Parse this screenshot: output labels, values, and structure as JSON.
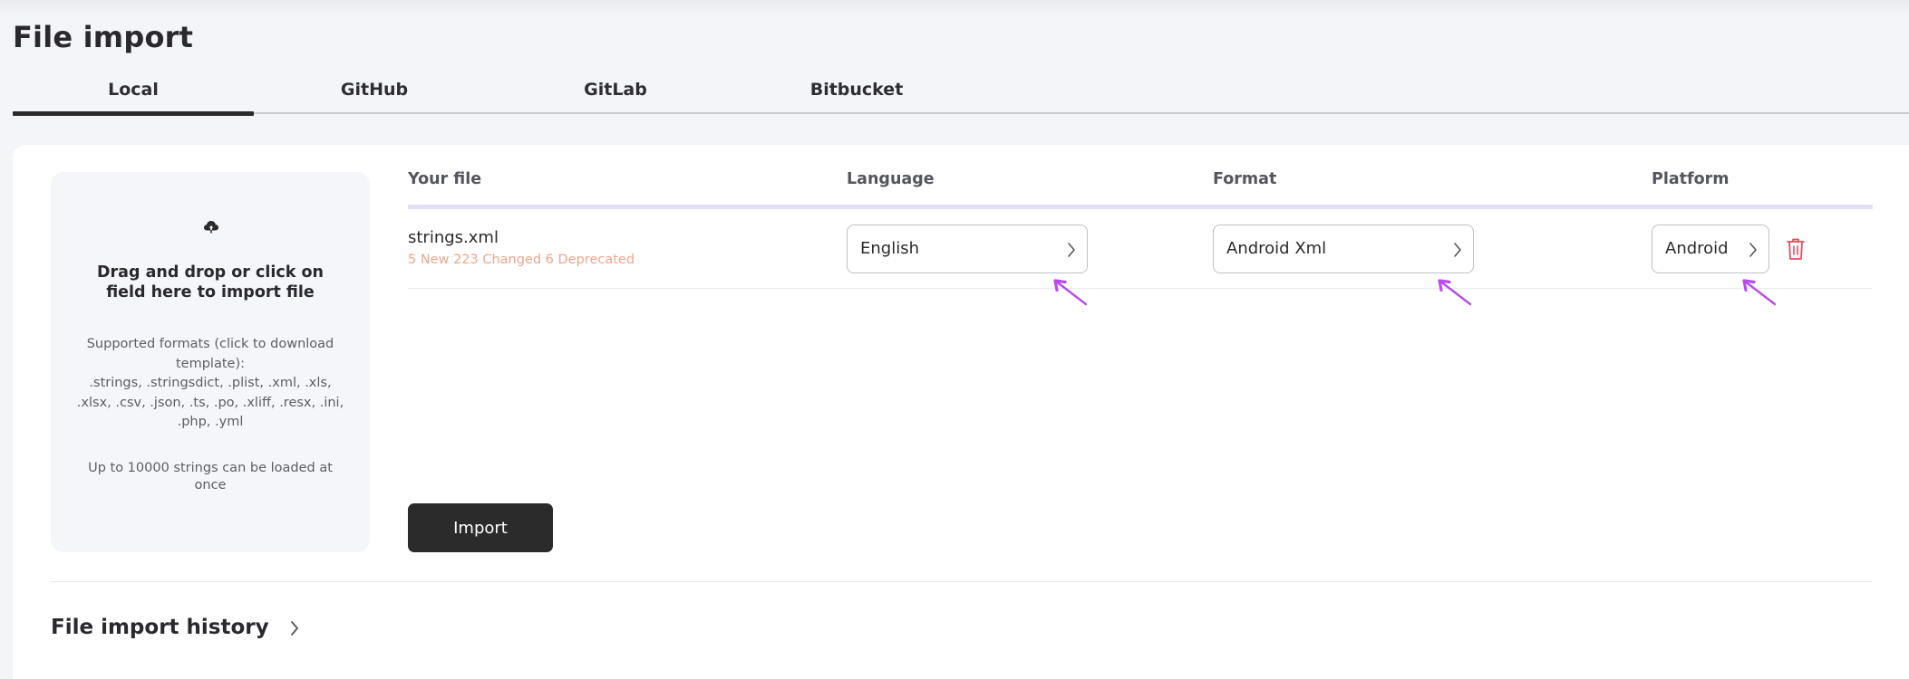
{
  "page": {
    "title": "File import"
  },
  "tabs": [
    {
      "label": "Local",
      "active": true
    },
    {
      "label": "GitHub",
      "active": false
    },
    {
      "label": "GitLab",
      "active": false
    },
    {
      "label": "Bitbucket",
      "active": false
    }
  ],
  "dropzone": {
    "icon": "upload-cloud-icon",
    "title": "Drag and drop or click on field here to import file",
    "formats_intro": "Supported formats (click to download template):",
    "formats_list": ".strings, .stringsdict, .plist, .xml, .xls, .xlsx, .csv, .json, .ts, .po, .xliff, .resx, .ini, .php, .yml",
    "limit": "Up to 10000 strings can be loaded at once"
  },
  "table": {
    "headers": {
      "file": "Your file",
      "language": "Language",
      "format": "Format",
      "platform": "Platform"
    },
    "rows": [
      {
        "file_name": "strings.xml",
        "stats": "5 New 223 Changed 6 Deprecated",
        "language": "English",
        "format": "Android Xml",
        "platform": "Android",
        "delete_icon": "trash-icon"
      }
    ]
  },
  "import_button": {
    "label": "Import"
  },
  "history": {
    "label": "File import history"
  },
  "colors": {
    "accent_dark": "#2b2b2b",
    "stats_text": "#eea68a",
    "header_rule": "#e1e0f5",
    "delete_icon": "#e04f5f",
    "annotation_arrow": "#b84ce8"
  }
}
